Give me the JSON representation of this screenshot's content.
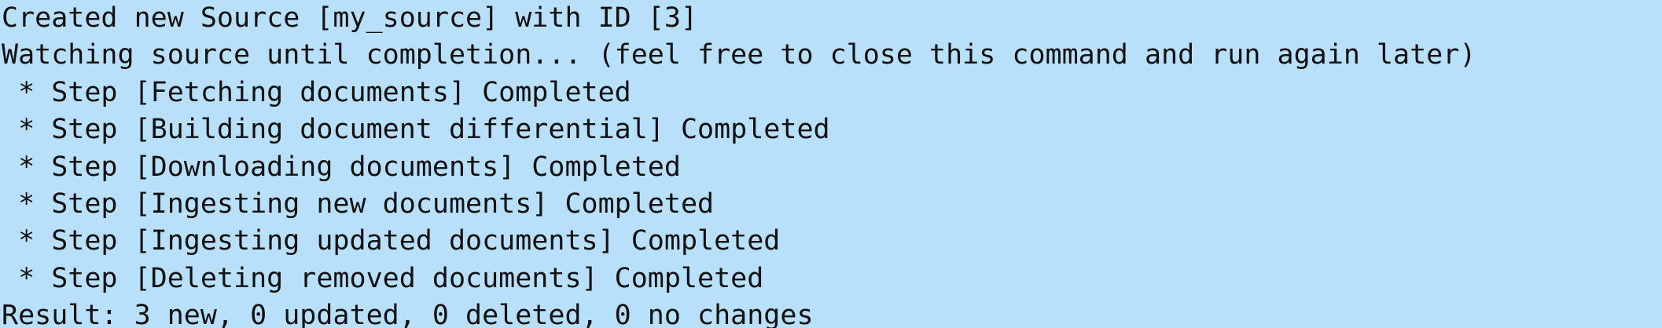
{
  "terminal": {
    "lines": [
      "Created new Source [my_source] with ID [3]",
      "Watching source until completion... (feel free to close this command and run again later)",
      " * Step [Fetching documents] Completed",
      " * Step [Building document differential] Completed",
      " * Step [Downloading documents] Completed",
      " * Step [Ingesting new documents] Completed",
      " * Step [Ingesting updated documents] Completed",
      " * Step [Deleting removed documents] Completed",
      "Result: 3 new, 0 updated, 0 deleted, 0 no changes"
    ]
  },
  "colors": {
    "background": "#b8e0fa",
    "text": "#111111"
  }
}
